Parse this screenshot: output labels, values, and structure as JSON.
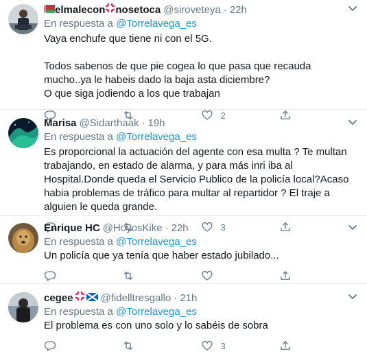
{
  "colors": {
    "link": "#1b95e0",
    "muted": "#657786",
    "text": "#14171a",
    "divider": "#e6ecf0"
  },
  "reply_prefix": "En respuesta a",
  "tweets": [
    {
      "name_a": "elmalecon",
      "name_b": "nosetoca",
      "handle": "@siroveteya",
      "time": "22h",
      "reply_to": "@Torrelavega_es",
      "text": "Vaya enchufe que tiene ni con el 5G.\n\nTodos sabenos de que pie cogea lo que pasa que recauda mucho..ya le habeis dado la baja asta diciembre?\nO que siga jodiendo a los que trabajan",
      "likes": "2"
    },
    {
      "name": "Marisa",
      "handle": "@Sidarthaak",
      "time": "19h",
      "reply_to": "@Torrelavega_es",
      "text": "Es proporcional la actuación del agente con esa multa ? Te multan trabajando, en estado de alarma, y para más inri iba al Hospital.Donde queda el Servicio Publico de la policía local?Acaso habia problemas de tráfico para multar al repartidor ? El traje a alguien le queda grande.",
      "likes": "3"
    },
    {
      "name": "Enrique HC",
      "handle": "@HoyosKike",
      "time": "22h",
      "reply_to": "@Torrelavega_es",
      "text": "Un policía que ya tenía que haber estado jubilado...",
      "likes": ""
    },
    {
      "name": "cegee",
      "handle": "@fidelltresgallo",
      "time": "21h",
      "reply_to": "@Torrelavega_es",
      "text": "El problema es con uno solo y lo sabéis de sobra",
      "likes": "3"
    }
  ]
}
